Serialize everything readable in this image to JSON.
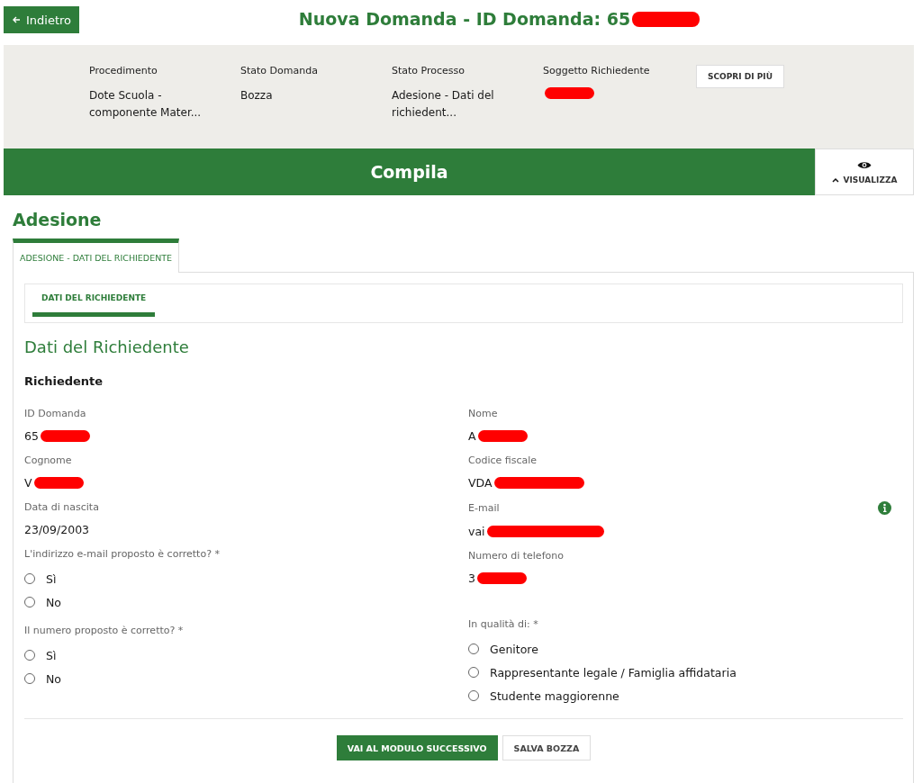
{
  "header": {
    "back_button": "Indietro",
    "title": "Nuova Domanda - ID Domanda: 65",
    "title_redacted": true
  },
  "summary": {
    "fields": [
      {
        "label": "Procedimento",
        "value": "Dote Scuola - componente Mater...",
        "redacted": false
      },
      {
        "label": "Stato Domanda",
        "value": "Bozza",
        "redacted": false
      },
      {
        "label": "Stato Processo",
        "value": "Adesione - Dati del richiedent...",
        "redacted": false
      },
      {
        "label": "Soggetto Richiedente",
        "redacted": true
      }
    ],
    "button": "SCOPRI DI PIÙ"
  },
  "mode_bar": {
    "title": "Compila",
    "toggle": "VISUALIZZA"
  },
  "section_title": "Adesione",
  "tabs": [
    {
      "label": "ADESIONE - DATI DEL RICHIEDENTE",
      "selected": true
    }
  ],
  "subtabs": [
    {
      "label": "DATI DEL RICHIEDENTE",
      "selected": true
    }
  ],
  "form_title": "Dati del Richiedente",
  "group_title": "Richiedente",
  "left_fields": [
    {
      "label": "ID Domanda",
      "value": "65",
      "redacted": true
    },
    {
      "label": "Cognome",
      "value": "V",
      "redacted": true
    },
    {
      "label": "Data di nascita",
      "value": "23/09/2003",
      "redacted": false
    }
  ],
  "right_fields": [
    {
      "label": "Nome",
      "value": "A",
      "redacted": true,
      "info": false
    },
    {
      "label": "Codice fiscale",
      "value": "VDA",
      "redacted": true,
      "info": false
    },
    {
      "label": "E-mail",
      "value": "vai",
      "redacted": true,
      "info": true
    },
    {
      "label": "Numero di telefono",
      "value": "3",
      "redacted": true,
      "info": false
    }
  ],
  "left_questions": [
    {
      "label": "L'indirizzo e-mail proposto è corretto? *",
      "options": [
        {
          "label": "Sì",
          "selected": false
        },
        {
          "label": "No",
          "selected": false
        }
      ]
    },
    {
      "label": "Il numero proposto è corretto? *",
      "options": [
        {
          "label": "Sì",
          "selected": false
        },
        {
          "label": "No",
          "selected": false
        }
      ]
    }
  ],
  "right_questions": [
    {
      "label": "In qualità di: *",
      "options": [
        {
          "label": "Genitore",
          "selected": false
        },
        {
          "label": "Rappresentante legale / Famiglia affidataria",
          "selected": false
        },
        {
          "label": "Studente maggiorenne",
          "selected": false
        }
      ]
    }
  ],
  "actions": [
    {
      "label": "VAI AL MODULO SUCCESSIVO",
      "kind": "primary"
    },
    {
      "label": "SALVA BOZZA",
      "kind": "secondary"
    }
  ]
}
